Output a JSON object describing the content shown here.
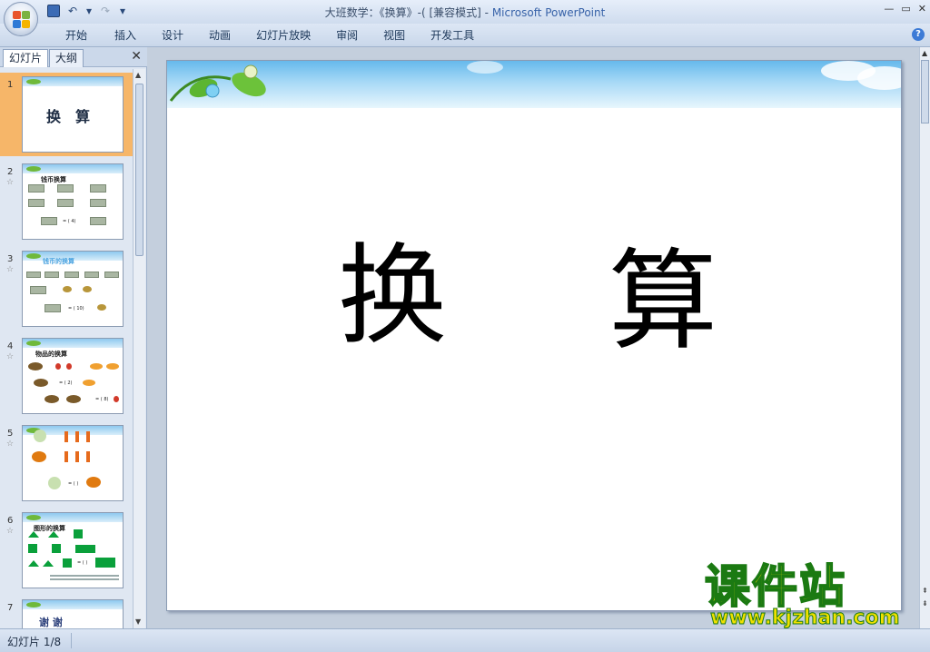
{
  "window": {
    "title_doc": "大班数学：《换算》-( [兼容模式]",
    "title_sep": " - ",
    "title_app": "Microsoft PowerPoint",
    "controls": [
      "—",
      "▭",
      "✕"
    ]
  },
  "qat": {
    "icons": [
      "save-icon",
      "undo-icon",
      "redo-icon",
      "customize-icon"
    ],
    "glyphs": [
      "💾",
      "↶",
      "▾",
      "↷",
      "▾"
    ]
  },
  "ribbon": {
    "tabs": [
      "开始",
      "插入",
      "设计",
      "动画",
      "幻灯片放映",
      "审阅",
      "视图",
      "开发工具"
    ],
    "help": "?"
  },
  "left_pane": {
    "tabs": [
      "幻灯片",
      "大纲"
    ],
    "close": "✕",
    "slides": [
      {
        "num": "1",
        "title": "换　算"
      },
      {
        "num": "2",
        "title": "钱币换算",
        "caption": "= ( 4)"
      },
      {
        "num": "3",
        "title": "钱币的换算",
        "caption": "= ( 10)"
      },
      {
        "num": "4",
        "title": "物品的换算",
        "caption": "= ( 2)",
        "caption2": "= ( 8)"
      },
      {
        "num": "5",
        "title": "",
        "caption": "= ( )"
      },
      {
        "num": "6",
        "title": "图形的换算",
        "caption": "= ( )"
      },
      {
        "num": "7",
        "title": "谢 谢"
      }
    ]
  },
  "slide": {
    "char1": "换",
    "char2": "算"
  },
  "status": {
    "text": "幻灯片 1/8"
  },
  "watermark": {
    "cn": "课件站",
    "url": "www.kjzhan.com"
  },
  "colors": {
    "accent": "#3762a8",
    "selection": "#f6b669",
    "watermark_fill": "#f0e000",
    "watermark_stroke": "#1b7a12"
  }
}
